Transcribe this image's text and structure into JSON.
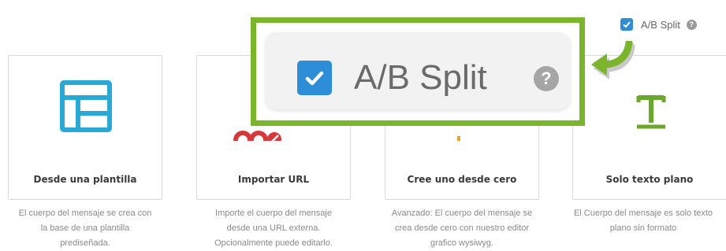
{
  "ab_split": {
    "label": "A/B Split",
    "checked": true,
    "help_icon": "question-circle-icon",
    "help_glyph": "?"
  },
  "callout": {
    "label": "A/B Split",
    "border_color": "#7ab52c",
    "arrow_icon": "curved-arrow-icon"
  },
  "options": [
    {
      "icon": "template-layout-icon",
      "title": "Desde una plantilla",
      "description": [
        "El cuerpo del mensaje se crea con",
        "la base de una plantilla",
        "prediseñada."
      ]
    },
    {
      "icon": "link-icon",
      "title": "Importar URL",
      "description": [
        "Importe el cuerpo del mensaje",
        "desde una URL externa.",
        "Opcionalmente puede editarlo."
      ]
    },
    {
      "icon": "pencil-icon",
      "title": "Cree uno desde cero",
      "description": [
        "Avanzado: El cuerpo del mensaje se",
        "crea desde cero con nuestro editor",
        "grafico wysiwyg."
      ]
    },
    {
      "icon": "text-icon",
      "title": "Solo texto plano",
      "description": [
        "El Cuerpo del mensaje es solo texto",
        "plano sin formato"
      ]
    }
  ],
  "colors": {
    "accent_blue": "#2d8dd6",
    "icon_teal": "#29a9d6",
    "icon_red": "#d9383a",
    "icon_green": "#6aa82c"
  }
}
